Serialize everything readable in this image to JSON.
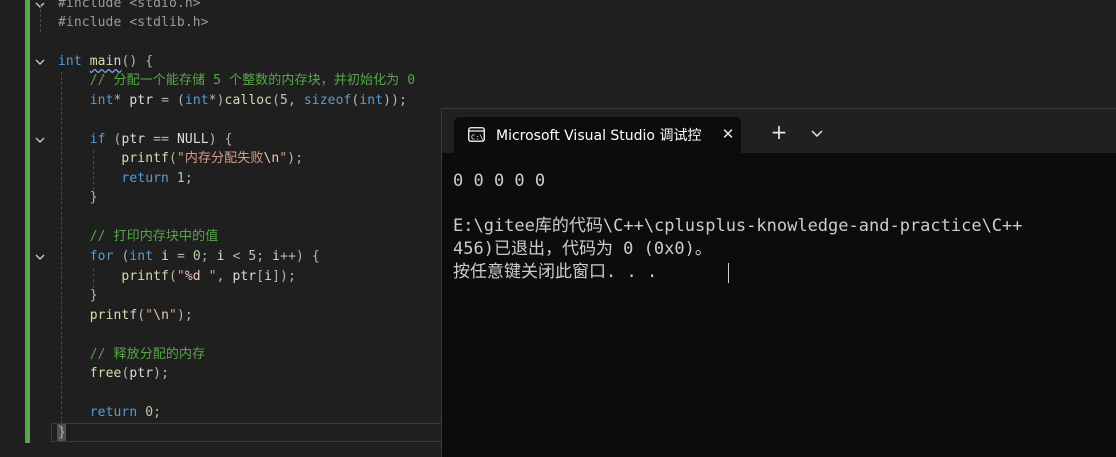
{
  "editor": {
    "lines": [
      "#include <stdio.h>",
      "#include <stdlib.h>",
      "",
      "int main() {",
      "    // 分配一个能存储 5 个整数的内存块，并初始化为 0",
      "    int* ptr = (int*)calloc(5, sizeof(int));",
      "",
      "    if (ptr == NULL) {",
      "        printf(\"内存分配失败\\n\");",
      "        return 1;",
      "    }",
      "",
      "    // 打印内存块中的值",
      "    for (int i = 0; i < 5; i++) {",
      "        printf(\"%d \", ptr[i]);",
      "    }",
      "    printf(\"\\n\");",
      "",
      "    // 释放分配的内存",
      "    free(ptr);",
      "",
      "    return 0;",
      "}"
    ]
  },
  "terminal": {
    "tab_title": "Microsoft Visual Studio 调试控",
    "close_glyph": "✕",
    "new_tab_glyph": "+",
    "output_lines": [
      "0 0 0 0 0",
      "",
      "E:\\gitee库的代码\\C++\\cplusplus-knowledge-and-practice\\C++",
      "456)已退出，代码为 0 (0x0)。",
      "按任意键关闭此窗口. . ."
    ]
  },
  "icons": {
    "fold": "chevron-down-icon",
    "terminal_tab": "console-app-icon",
    "dropdown": "chevron-down-icon"
  },
  "colors": {
    "editor_bg": "#1f1f1f",
    "terminal_bg": "#0c0c0c",
    "titlebar_bg": "#202020",
    "keyword": "#569cd6",
    "comment": "#57a64a",
    "function": "#dcdcaa",
    "string": "#d69d85",
    "change_bar": "#57a64a"
  }
}
